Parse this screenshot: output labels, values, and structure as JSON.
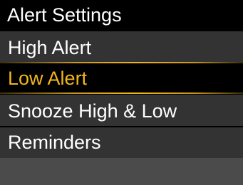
{
  "header": {
    "title": "Alert Settings"
  },
  "menu": {
    "items": [
      {
        "label": "High Alert"
      },
      {
        "label": "Low Alert",
        "selected": true
      },
      {
        "label": "Snooze High & Low"
      },
      {
        "label": "Reminders"
      }
    ]
  },
  "colors": {
    "background": "#000000",
    "item_background": "#333333",
    "selected_text": "#f2b51c",
    "text": "#ffffff",
    "footer": "#4b4b4b"
  }
}
